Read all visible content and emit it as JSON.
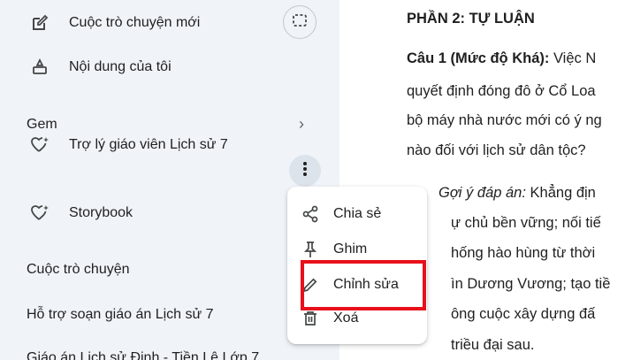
{
  "sidebar": {
    "new_chat": "Cuộc trò chuyện mới",
    "my_content": "Nội dung của tôi",
    "gem_section": "Gem",
    "gems": [
      "Trợ lý giáo viên Lịch sử 7",
      "Storybook"
    ],
    "chats_section": "Cuộc trò chuyện",
    "chats": [
      "Hỗ trợ soạn giáo án Lịch sử 7",
      "Giáo án Lịch sử Đinh - Tiền Lê Lớp 7"
    ]
  },
  "context_menu": {
    "items": [
      "Chia sẻ",
      "Ghim",
      "Chỉnh sửa",
      "Xoá"
    ]
  },
  "main": {
    "heading": "PHẦN 2: TỰ LUẬN",
    "q_label": "Câu 1 (Mức độ Khá):",
    "q_line1": " Việc N",
    "q_line2": "quyết định đóng đô ở Cổ Loa",
    "q_line3": "bộ máy nhà nước mới có ý ng",
    "q_line4": "nào đối với lịch sử dân tộc?",
    "hint_label": "Gợi ý đáp án:",
    "hint_line1": " Khẳng địn",
    "hint_line2": "ự chủ bền vững; nối tiế",
    "hint_line3": "hống hào hùng từ thời",
    "hint_line4": "ìn Dương Vương; tạo tiề",
    "hint_line5": "ông cuộc xây dựng đấ",
    "hint_line6": "triều đại sau."
  },
  "colors": {
    "sidebar_bg": "#f0f4f9",
    "highlight": "#e8101a"
  }
}
